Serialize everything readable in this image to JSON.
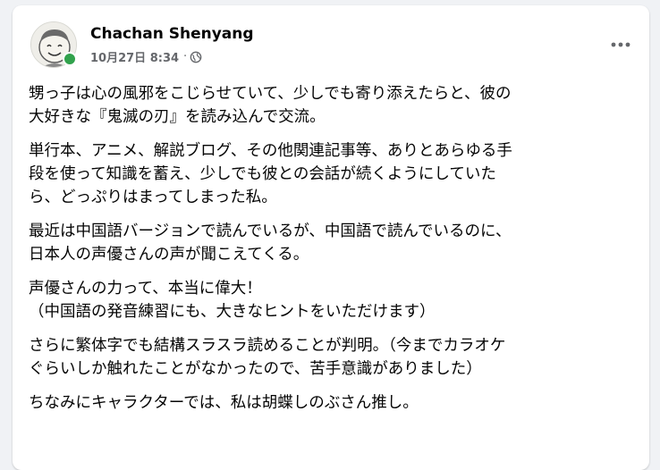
{
  "post": {
    "author": "Chachan Shenyang",
    "timestamp": "10月27日 8:34",
    "separator": "·",
    "privacy_icon": "globe-icon",
    "online_color": "#31a24c",
    "paragraphs": [
      [
        "甥っ子は心の風邪をこじらせていて、少しでも寄り添えたらと、彼の",
        "大好きな『鬼滅の刃』を読み込んで交流。"
      ],
      [
        "単行本、アニメ、解説ブログ、その他関連記事等、ありとあらゆる手",
        "段を使って知識を蓄え、少しでも彼との会話が続くようにしていた",
        "ら、どっぷりはまってしまった私。"
      ],
      [
        "最近は中国語バージョンで読んでいるが、中国語で読んでいるのに、",
        "日本人の声優さんの声が聞こえてくる。"
      ],
      [
        "声優さんの力って、本当に偉大！",
        "（中国語の発音練習にも、大きなヒントをいただけます）"
      ],
      [
        "さらに繁体字でも結構スラスラ読めることが判明。（今までカラオケ",
        "ぐらいしか触れたことがなかったので、苦手意識がありました）"
      ],
      [
        "ちなみにキャラクターでは、私は胡蝶しのぶさん推し。"
      ]
    ]
  }
}
